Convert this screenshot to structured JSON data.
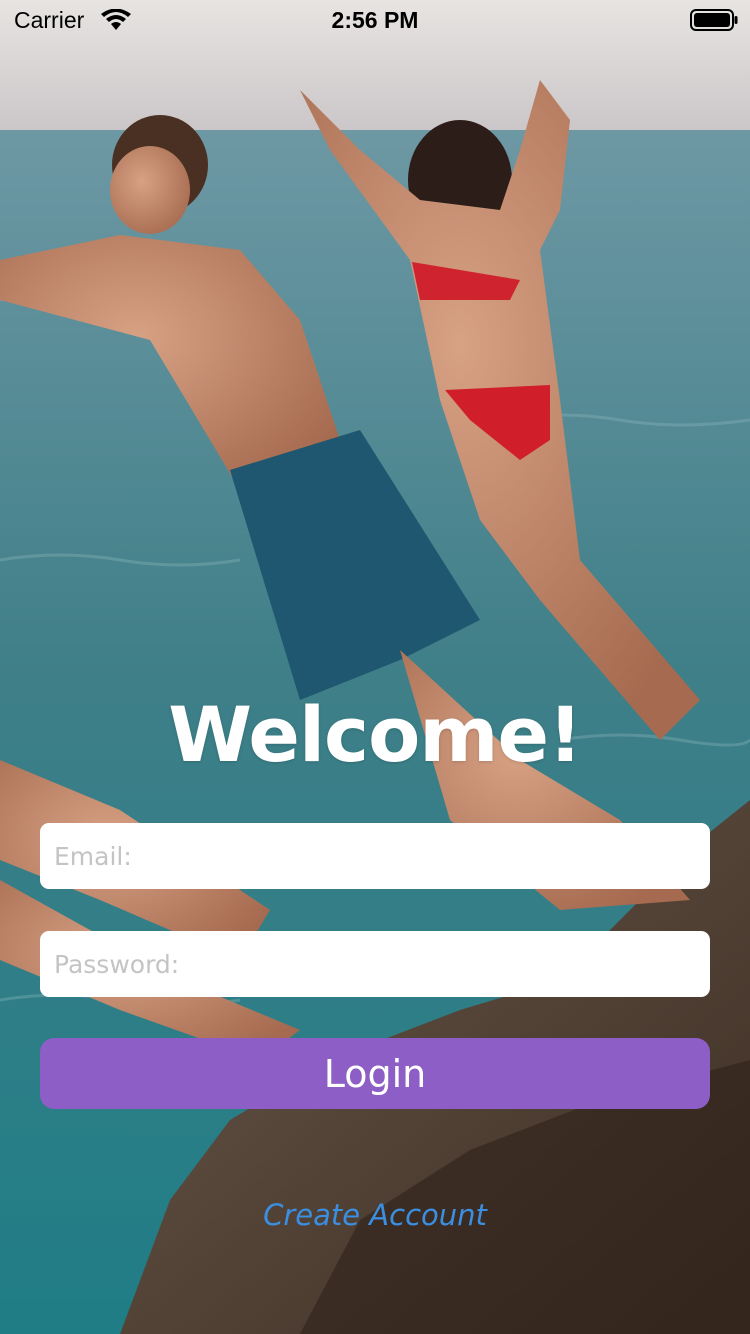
{
  "status_bar": {
    "carrier": "Carrier",
    "time": "2:56 PM",
    "wifi_icon": "wifi-icon",
    "battery_icon": "battery-icon"
  },
  "background": {
    "description_icon": "photo-people-jumping-into-sea"
  },
  "login_form": {
    "title": "Welcome!",
    "email_placeholder": "Email:",
    "email_value": "",
    "password_placeholder": "Password:",
    "password_value": "",
    "login_label": "Login",
    "create_account_label": "Create Account"
  },
  "colors": {
    "login_button": "#8d5fc6",
    "link": "#3b8ee0",
    "title": "#ffffff"
  }
}
